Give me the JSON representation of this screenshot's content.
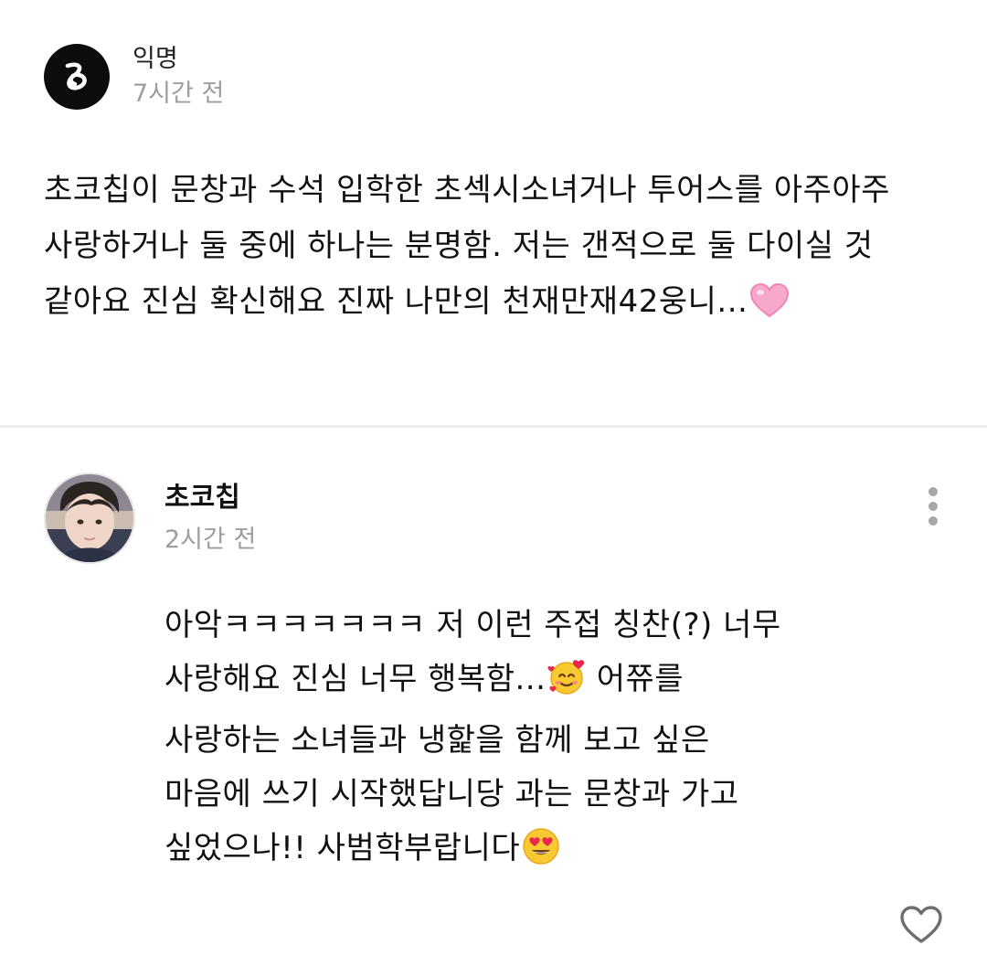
{
  "post": {
    "author": "익명",
    "time": "7시간 전",
    "avatar_icon": "anonymous-logo-icon",
    "body": "초코칩이 문창과 수석 입학한 초섹시소녀거나 투어스를 아주아주 사랑하거나 둘 중에 하나는 분명함. 저는 갠적으로 둘 다이실 것 같아요 진심 확신해요 진짜 나만의 천재만재42웅니...",
    "trailing_emoji": "pink-heart-emoji"
  },
  "answer": {
    "author": "초코칩",
    "time": "2시간 전",
    "avatar_icon": "user-profile-photo",
    "body_parts": [
      "아악ㅋㅋㅋㅋㅋㅋㅋ 저 이런 주접 칭찬(?) 너무 사랑해요 진심 너무 행복함...",
      " 어쮸를 사랑하는 소녀들과 냉핥을 함께 보고 싶은 마음에 쓰기 시작했답니당 과는 문창과 가고 싶었으나!! 사범학부랍니다"
    ],
    "emojis": [
      "smiling-face-with-hearts-emoji",
      "heart-eyes-emoji"
    ],
    "more_icon": "more-vertical-icon",
    "like_icon": "heart-outline-icon"
  },
  "colors": {
    "text": "#111111",
    "muted": "#9e9e9e",
    "divider": "#ececec",
    "icon": "#a8a8a8"
  }
}
